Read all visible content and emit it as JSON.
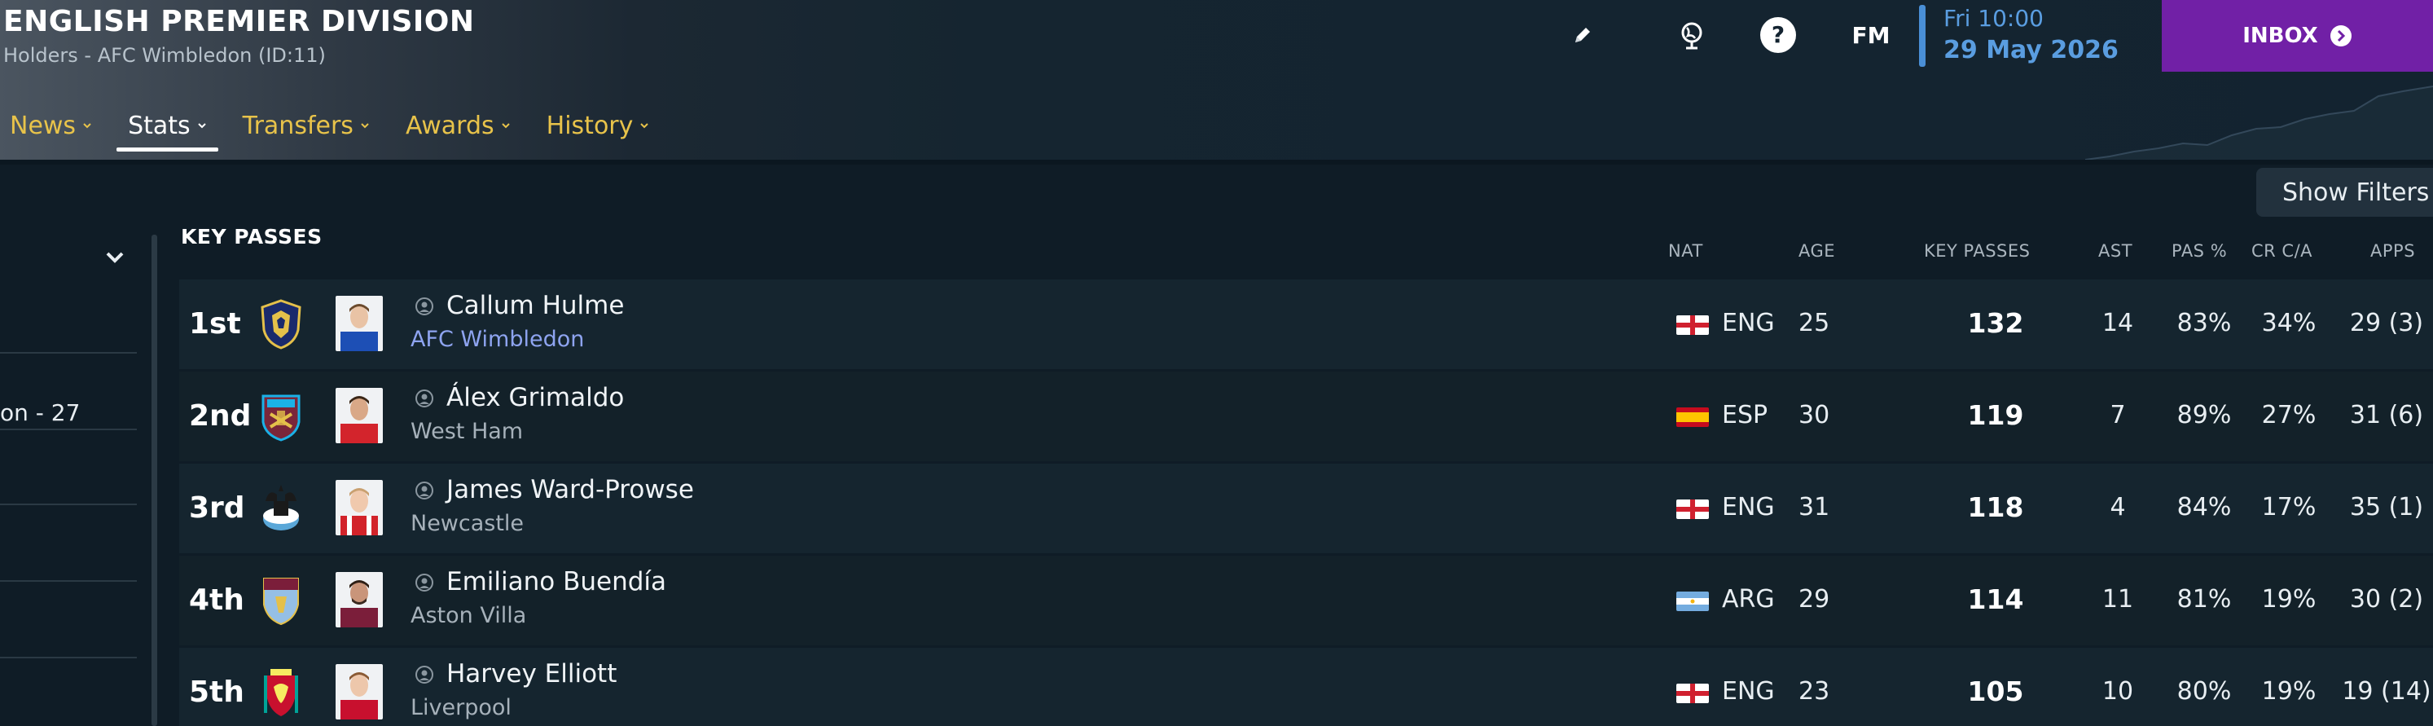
{
  "header": {
    "title": "ENGLISH PREMIER DIVISION",
    "subtitle": "Holders - AFC Wimbledon (ID:11)",
    "date_day": "Fri 10:00",
    "date_full": "29 May 2026",
    "inbox_label": "INBOX",
    "fm_label": "FM",
    "help_label": "?",
    "accent_color": "#7120a6",
    "date_color": "#5a9de0"
  },
  "nav": {
    "tabs": [
      {
        "label": "News",
        "active": false
      },
      {
        "label": "Stats",
        "active": true
      },
      {
        "label": "Transfers",
        "active": false
      },
      {
        "label": "Awards",
        "active": false
      },
      {
        "label": "History",
        "active": false
      }
    ]
  },
  "filters": {
    "show_label": "Show Filters"
  },
  "left_panel": {
    "partial_text": "on - 27"
  },
  "table": {
    "section_title": "KEY PASSES",
    "columns": {
      "nat": "NAT",
      "age": "AGE",
      "key_passes": "KEY PASSES",
      "ast": "AST",
      "pas": "PAS %",
      "cr": "CR C/A",
      "apps": "APPS"
    },
    "rows": [
      {
        "rank": "1st",
        "name": "Callum Hulme",
        "club": "AFC Wimbledon",
        "club_link": true,
        "nat": "ENG",
        "age": "25",
        "key_passes": "132",
        "ast": "14",
        "pas": "83%",
        "cr": "34%",
        "apps": "29 (3)",
        "badge": "wimbledon-badge",
        "kit": "#1d4fb5",
        "skin": "#e9c3a5"
      },
      {
        "rank": "2nd",
        "name": "Álex Grimaldo",
        "club": "West Ham",
        "club_link": false,
        "nat": "ESP",
        "age": "30",
        "key_passes": "119",
        "ast": "7",
        "pas": "89%",
        "cr": "27%",
        "apps": "31 (6)",
        "badge": "westham-badge",
        "kit": "#d3242c",
        "skin": "#d9a887"
      },
      {
        "rank": "3rd",
        "name": "James Ward-Prowse",
        "club": "Newcastle",
        "club_link": false,
        "nat": "ENG",
        "age": "31",
        "key_passes": "118",
        "ast": "4",
        "pas": "84%",
        "cr": "17%",
        "apps": "35 (1)",
        "badge": "newcastle-badge",
        "kit": "#d2232a",
        "skin": "#f0c9ad"
      },
      {
        "rank": "4th",
        "name": "Emiliano Buendía",
        "club": "Aston Villa",
        "club_link": false,
        "nat": "ARG",
        "age": "29",
        "key_passes": "114",
        "ast": "11",
        "pas": "81%",
        "cr": "19%",
        "apps": "30 (2)",
        "badge": "astonvilla-badge",
        "kit": "#7b1e3a",
        "skin": "#c9957a"
      },
      {
        "rank": "5th",
        "name": "Harvey Elliott",
        "club": "Liverpool",
        "club_link": false,
        "nat": "ENG",
        "age": "23",
        "key_passes": "105",
        "ast": "10",
        "pas": "80%",
        "cr": "19%",
        "apps": "19 (14)",
        "badge": "liverpool-badge",
        "kit": "#c8102e",
        "skin": "#edc7ab"
      }
    ]
  }
}
